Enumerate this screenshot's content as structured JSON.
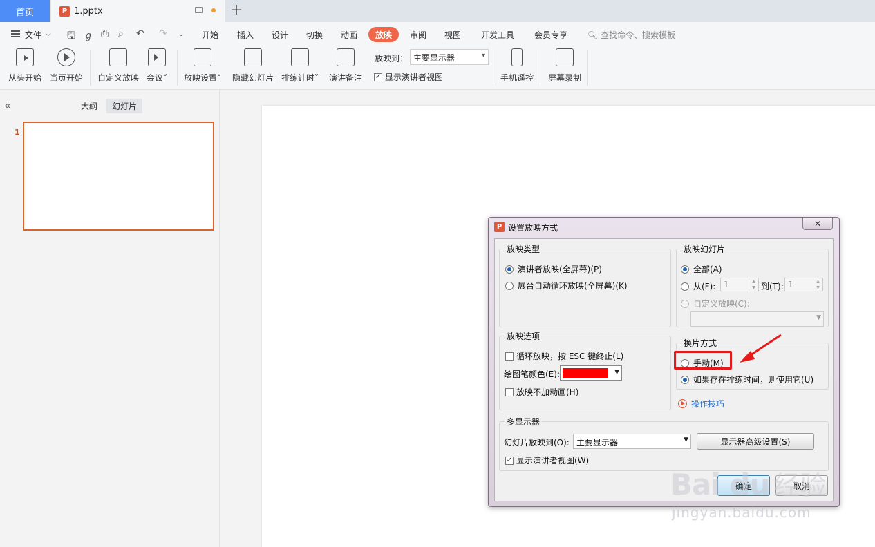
{
  "tabs": {
    "home": "首页",
    "document": "1.pptx",
    "doc_icon": "P"
  },
  "menu": {
    "file": "文件",
    "items": [
      "开始",
      "插入",
      "设计",
      "切换",
      "动画",
      "放映",
      "审阅",
      "视图",
      "开发工具",
      "会员专享"
    ],
    "active": "放映",
    "search_placeholder": "查找命令、搜索模板"
  },
  "ribbon": {
    "from_start": "从头开始",
    "from_current": "当页开始",
    "custom_show": "自定义放映",
    "meeting": "会议",
    "show_settings": "放映设置",
    "hide_slide": "隐藏幻灯片",
    "rehearse": "排练计时",
    "speaker_notes": "演讲备注",
    "show_to_label": "放映到：",
    "show_to_value": "主要显示器",
    "presenter_view": "显示演讲者视图",
    "phone_remote": "手机遥控",
    "screen_record": "屏幕录制"
  },
  "left_panel": {
    "outline": "大纲",
    "slides": "幻灯片",
    "slide_number": "1"
  },
  "dialog": {
    "title": "设置放映方式",
    "close": "✕",
    "show_type": {
      "title": "放映类型",
      "option1": "演讲者放映(全屏幕)(P)",
      "option2": "展台自动循环放映(全屏幕)(K)"
    },
    "show_slides": {
      "title": "放映幻灯片",
      "all": "全部(A)",
      "from": "从(F):",
      "from_value": "1",
      "to": "到(T):",
      "to_value": "1",
      "custom": "自定义放映(C):"
    },
    "show_options": {
      "title": "放映选项",
      "loop": "循环放映，按 ESC 键终止(L)",
      "pen_color": "绘图笔颜色(E):",
      "pen_color_value": "#ff0000",
      "no_animation": "放映不加动画(H)"
    },
    "advance": {
      "title": "换片方式",
      "manual": "手动(M)",
      "timings": "如果存在排练时间，则使用它(U)"
    },
    "tips": "操作技巧",
    "multi_display": {
      "title": "多显示器",
      "show_on": "幻灯片放映到(O):",
      "show_on_value": "主要显示器",
      "advanced": "显示器高级设置(S)",
      "presenter_view": "显示演讲者视图(W)"
    },
    "ok": "确定",
    "cancel": "取消"
  },
  "watermark": {
    "logo": "Bai du",
    "jingyan": "经验",
    "url": "jingyan.baidu.com"
  },
  "colors": {
    "accent": "#f0664a",
    "home_tab": "#4e8cf7",
    "annotation": "#e61a1a"
  }
}
